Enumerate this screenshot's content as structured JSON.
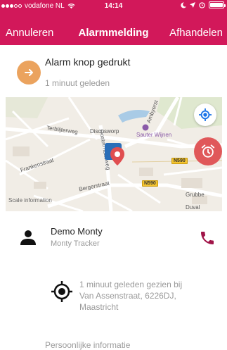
{
  "status_bar": {
    "carrier": "vodafone NL",
    "time": "14:14"
  },
  "nav": {
    "cancel": "Annuleren",
    "title": "Alarmmelding",
    "handle": "Afhandelen"
  },
  "alarm": {
    "title": "Alarm knop gedrukt",
    "time_ago": "1 minuut geleden"
  },
  "map": {
    "labels": {
      "terblijterweg": "Terblijterweg",
      "discusworp": "Discusworp",
      "sauter": "Sauter Wijnen",
      "ambyerst": "Ambyerst",
      "oostermaasweg": "Oostermaasweg",
      "frankenstraat": "Frankenstraat",
      "bergerstraat": "Bergerstraat",
      "grubbe": "Grubbe",
      "duval": "Duval",
      "n590_a": "N590",
      "n590_b": "N590",
      "scale": "Scale information"
    }
  },
  "person": {
    "name": "Demo Monty",
    "device": "Monty Tracker"
  },
  "last_seen": {
    "line1": "1 minuut geleden gezien bij",
    "line2": "Van Assenstraat, 6226DJ,",
    "line3": "Maastricht"
  },
  "personal_info_label": "Persoonlijke informatie",
  "colors": {
    "header": "#d2185a",
    "alarm_badge": "#eba35e",
    "fab": "#e0585a",
    "locate": "#1a73e8",
    "phone": "#a01448"
  }
}
